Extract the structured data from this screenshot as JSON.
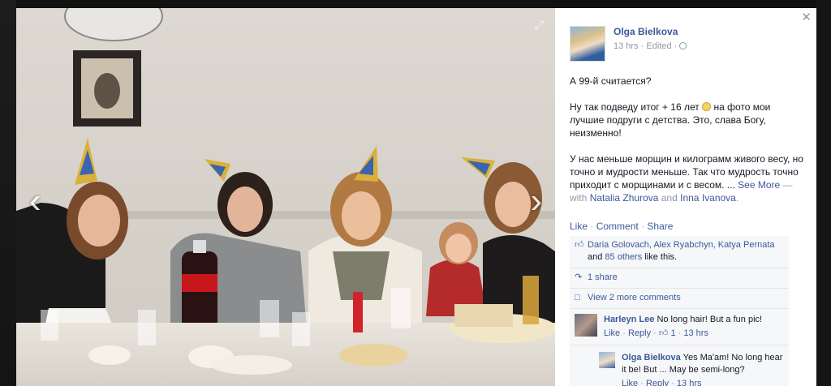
{
  "author": {
    "name": "Olga Bielkova",
    "time": "13 hrs",
    "edited": "Edited"
  },
  "post": {
    "p1": "А 99-й считается?",
    "p2a": "Ну так подведу итог + 16 лет",
    "p2b": "на фото мои лучшие подруги с детства. Это, слава Богу, неизменно!",
    "p3a": "У нас меньше морщин и килограмм живого весу, но точно и мудрости меньше. Так что мудрость точно приходит с морщинами и с весом. ...",
    "see_more": "See More",
    "with_label": "— with",
    "tag1": "Natalia Zhurova",
    "and": "and",
    "tag2": "Inna Ivanova",
    "period": "."
  },
  "actions": {
    "like": "Like",
    "comment": "Comment",
    "share": "Share"
  },
  "ufi": {
    "likes_names": "Daria Golovach, Alex Ryabchyn, Katya Pernata",
    "likes_and": "and",
    "likes_others": "85 others",
    "likes_suffix": "like this.",
    "shares": "1 share",
    "view_more": "View 2 more comments"
  },
  "comments": [
    {
      "name": "Harleyn Lee",
      "text": "No long hair! But a fun pic!",
      "like": "Like",
      "reply": "Reply",
      "likes": "1",
      "time": "13 hrs"
    }
  ],
  "reply": {
    "name": "Olga Bielkova",
    "text": "Yes Ma'am! No long hear it be! But ... May be semi-long?",
    "like": "Like",
    "reply": "Reply",
    "time": "13 hrs"
  },
  "colors": {
    "link": "#3b5998",
    "meta": "#9197a3"
  }
}
